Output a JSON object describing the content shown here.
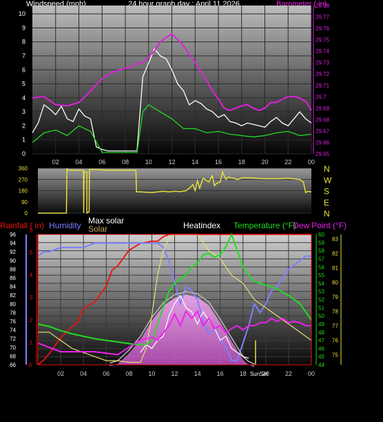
{
  "header": {
    "windspeed_label": "Windspeed (mph)",
    "title": "24 hour graph day : April 11 2026",
    "barometer_label": "Barometer ( in)"
  },
  "direction_letters": [
    "N",
    "W",
    "S",
    "E",
    "N"
  ],
  "bottom_labels": {
    "rainfall": "Rainfall ( in)",
    "humidity": "Humidity",
    "max_solar": "Max solar",
    "solar": "Solar",
    "heatindex": "Heatindex",
    "temperature": "Temperature (°F)",
    "dew_point": "Dew Point (°F)",
    "sunset": "SunSet"
  },
  "colors": {
    "windspeed": "#ffffff",
    "gust_avg": "#22dd22",
    "barometer": "#dd22dd",
    "direction": "#e8e040",
    "rainfall": "#ee1111",
    "humidity": "#7f7fff",
    "max_solar": "#bbbbbb",
    "solar": "#e8e070",
    "heatindex": "#ffffff",
    "temperature": "#22dd22",
    "dew_point": "#ee22ee"
  },
  "chart_data": [
    {
      "type": "line",
      "title": "24 hour graph day : April 11 2026",
      "x_ticks": [
        "02",
        "04",
        "06",
        "08",
        "10",
        "12",
        "14",
        "16",
        "18",
        "20",
        "22",
        "00"
      ],
      "ylabel_left": "Windspeed (mph)",
      "ylim_left": [
        0,
        10.6
      ],
      "yticks_left": [
        0,
        1,
        2,
        3,
        4,
        5,
        6,
        7,
        8,
        9,
        10
      ],
      "ylabel_right": "Barometer ( in)",
      "ylim_right": [
        29.65,
        29.78
      ],
      "yticks_right": [
        29.65,
        29.66,
        29.67,
        29.68,
        29.69,
        29.7,
        29.71,
        29.72,
        29.73,
        29.74,
        29.75,
        29.76,
        29.77,
        29.78
      ],
      "series": [
        {
          "name": "Windspeed (mph)",
          "axis": "left",
          "x": [
            0,
            0.5,
            1,
            1.5,
            2,
            2.5,
            3,
            3.5,
            4,
            4.5,
            5,
            5.5,
            6,
            6.5,
            7,
            7.5,
            8,
            8.5,
            9,
            9.5,
            10,
            10.5,
            11,
            11.5,
            12,
            12.5,
            13,
            13.5,
            14,
            14.5,
            15,
            15.5,
            16,
            16.5,
            17,
            17.5,
            18,
            18.5,
            19,
            19.5,
            20,
            20.5,
            21,
            21.5,
            22,
            22.5,
            23,
            23.5,
            24
          ],
          "y": [
            1.5,
            2.2,
            3.5,
            3.2,
            2.8,
            3.4,
            2.5,
            2.3,
            3.2,
            2.7,
            2.5,
            0.5,
            0.3,
            0.2,
            0.2,
            0.2,
            0.2,
            0.2,
            0.2,
            5.5,
            6.5,
            7.5,
            7.0,
            6.8,
            6.0,
            5.0,
            4.5,
            3.5,
            3.8,
            3.6,
            3.2,
            3.0,
            2.6,
            2.8,
            2.3,
            2.2,
            2.0,
            2.2,
            2.1,
            2.0,
            1.9,
            2.3,
            2.6,
            2.2,
            2.0,
            2.5,
            3.0,
            2.5,
            2.2
          ]
        },
        {
          "name": "Average wind",
          "axis": "left",
          "x": [
            0,
            1,
            2,
            3,
            4,
            5,
            6,
            7,
            8,
            9,
            9.5,
            10,
            11,
            12,
            13,
            14,
            15,
            16,
            17,
            18,
            19,
            20,
            21,
            22,
            23,
            24
          ],
          "y": [
            0.8,
            1.5,
            1.7,
            1.3,
            2.0,
            1.6,
            0.1,
            0.1,
            0.1,
            0.1,
            3.0,
            3.5,
            3.0,
            2.5,
            1.8,
            1.8,
            1.5,
            1.6,
            1.4,
            1.3,
            1.2,
            1.3,
            1.5,
            1.6,
            1.3,
            1.4
          ]
        },
        {
          "name": "Barometer ( in)",
          "axis": "right",
          "x": [
            0,
            1,
            2,
            3,
            4,
            5,
            6,
            7,
            8,
            8.5,
            9,
            9.5,
            10,
            10.5,
            11,
            11.5,
            12,
            12.5,
            13,
            13.5,
            14,
            14.5,
            15,
            15.5,
            16,
            16.5,
            17,
            17.5,
            18,
            18.5,
            19,
            19.5,
            20,
            20.5,
            21,
            21.5,
            22,
            22.5,
            23,
            23.3,
            23.6,
            24
          ],
          "y": [
            29.699,
            29.7,
            29.693,
            29.692,
            29.695,
            29.705,
            29.716,
            29.722,
            29.725,
            29.726,
            29.729,
            29.73,
            29.735,
            29.74,
            29.748,
            29.752,
            29.755,
            29.75,
            29.745,
            29.737,
            29.73,
            29.722,
            29.714,
            29.705,
            29.698,
            29.69,
            29.688,
            29.69,
            29.692,
            29.693,
            29.69,
            29.688,
            29.69,
            29.695,
            29.695,
            29.698,
            29.7,
            29.7,
            29.699,
            29.697,
            29.695,
            29.688
          ]
        }
      ]
    },
    {
      "type": "line",
      "title": "",
      "x_ticks": [],
      "ylabel_left": "",
      "ylim_left": [
        0,
        360
      ],
      "yticks_left": [
        0,
        90,
        180,
        270,
        360
      ],
      "y_right_labels": [
        "N",
        "W",
        "S",
        "E",
        "N"
      ],
      "series": [
        {
          "name": "Wind direction",
          "axis": "left",
          "x": [
            0,
            2.5,
            2.55,
            2.6,
            4,
            4.02,
            4.05,
            4.3,
            4.3,
            4.5,
            4.52,
            5,
            6,
            7,
            8,
            8.6,
            8.65,
            9,
            10,
            11,
            11.5,
            12,
            12.5,
            13,
            13.3,
            13.6,
            13.8,
            14,
            14.2,
            14.5,
            15,
            15.3,
            15.5,
            15.7,
            16,
            16.2,
            16.5,
            16.7,
            17,
            17.2,
            17.5,
            18,
            19,
            20,
            21,
            22,
            23,
            23.3,
            23.5,
            23.7,
            24
          ],
          "y": [
            0,
            0,
            360,
            345,
            345,
            0,
            330,
            330,
            0,
            10,
            350,
            350,
            345,
            345,
            345,
            345,
            170,
            170,
            165,
            175,
            170,
            175,
            172,
            180,
            200,
            230,
            180,
            260,
            200,
            280,
            250,
            300,
            220,
            240,
            250,
            330,
            270,
            290,
            280,
            280,
            270,
            285,
            280,
            275,
            275,
            280,
            270,
            250,
            165,
            175,
            170
          ]
        }
      ]
    },
    {
      "type": "line",
      "title": "",
      "x_ticks": [
        "02",
        "04",
        "06",
        "08",
        "10",
        "12",
        "14",
        "16",
        "18",
        "20",
        "22",
        "00"
      ],
      "axes": {
        "rainfall": {
          "label": "Rainfall ( in)",
          "ticks": [
            0,
            0.1,
            0.2,
            0.3,
            0.4,
            0.5,
            0.6
          ],
          "ylim": [
            0,
            0.58
          ]
        },
        "humidity": {
          "label": "Humidity",
          "ticks": [
            66,
            68,
            70,
            72,
            74,
            76,
            78,
            80,
            82,
            84,
            86,
            88,
            90,
            92,
            94,
            96
          ],
          "ylim": [
            66,
            96
          ]
        },
        "temperature": {
          "label": "Temperature (°F)",
          "ticks": [
            44,
            45,
            46,
            47,
            48,
            49,
            50,
            51,
            52,
            53,
            54,
            55,
            56,
            57,
            58,
            59,
            60
          ],
          "ylim": [
            44,
            60
          ]
        },
        "dew_point": {
          "label": "Dew Point (°F)",
          "ticks": [
            75,
            76,
            77,
            78,
            79,
            80,
            81,
            82,
            83
          ],
          "ylim": [
            74.3,
            83.3
          ]
        }
      },
      "annotations": [
        {
          "text": "SunSet",
          "x": 19.1
        }
      ],
      "series": [
        {
          "name": "Rainfall ( in)",
          "axis": "rainfall",
          "x": [
            0,
            0.5,
            1,
            2,
            3,
            3.5,
            4,
            5,
            6,
            6.5,
            7,
            8,
            9,
            10,
            10.5,
            11,
            11.5,
            12,
            24
          ],
          "y": [
            0,
            0.02,
            0.05,
            0.12,
            0.17,
            0.19,
            0.25,
            0.28,
            0.35,
            0.42,
            0.44,
            0.51,
            0.54,
            0.55,
            0.55,
            0.57,
            0.58,
            0.58,
            0.58
          ]
        },
        {
          "name": "Humidity",
          "axis": "humidity",
          "x": [
            0,
            0.5,
            1,
            2,
            3,
            4,
            5,
            6,
            7,
            8,
            9,
            10,
            10.5,
            11,
            11.5,
            12,
            12.5,
            13,
            13.5,
            14,
            14.5,
            15,
            15.5,
            16,
            16.5,
            17,
            17.5,
            18,
            18.5,
            19,
            19.5,
            20,
            20.5,
            21,
            21.5,
            22,
            22.5,
            23,
            23.5,
            24
          ],
          "y": [
            91,
            92,
            92,
            93,
            93,
            93,
            94,
            94,
            94,
            94,
            94,
            94,
            94,
            93,
            90,
            85,
            80,
            84,
            83,
            81,
            76,
            73,
            74,
            72,
            70,
            67,
            67,
            71,
            75,
            80,
            78,
            80,
            83,
            84,
            86,
            88,
            89,
            90,
            91,
            91
          ]
        },
        {
          "name": "Max solar",
          "axis": "temperature",
          "x": [
            6.3,
            7,
            8,
            9,
            10,
            11,
            12,
            13,
            14,
            15,
            16,
            17,
            18,
            18.5,
            19
          ],
          "y": [
            44.2,
            44.5,
            45.8,
            47.5,
            49.8,
            51.6,
            52.6,
            53,
            52.7,
            51.7,
            49.6,
            47.3,
            45,
            44.4,
            44.1
          ]
        },
        {
          "name": "Solar",
          "axis": "temperature",
          "x": [
            0,
            1,
            2,
            3,
            4,
            5,
            6,
            7,
            8,
            9,
            9.5,
            10,
            10.5,
            11,
            11.5,
            12,
            12.5,
            13,
            13.5,
            14,
            14.5,
            15,
            16,
            17,
            18,
            19,
            20,
            21,
            22,
            23,
            24
          ],
          "y": [
            48,
            48,
            47,
            46,
            45.5,
            45,
            44.5,
            44.5,
            44.3,
            44.3,
            46,
            50,
            55,
            58,
            59.5,
            60,
            60,
            60,
            60,
            60,
            59,
            58,
            57,
            55,
            54,
            52,
            51,
            50,
            49,
            48,
            47
          ]
        },
        {
          "name": "Heatindex",
          "axis": "temperature",
          "x": [
            9,
            9.5,
            10,
            10.5,
            11,
            11.5,
            12,
            12.5,
            13,
            13.5,
            14,
            14.5,
            15,
            15.5,
            16,
            16.5,
            17,
            17.5,
            18,
            18.5
          ],
          "y": [
            45.5,
            46.5,
            46,
            47,
            47.5,
            50,
            51.5,
            52.5,
            51,
            50.5,
            49,
            50.5,
            49.5,
            48.5,
            47,
            47.5,
            46,
            45.5,
            45,
            44.8
          ]
        },
        {
          "name": "Temperature (°F)",
          "axis": "temperature",
          "x": [
            0,
            1,
            2,
            3,
            4,
            5,
            6,
            7,
            8,
            8.5,
            9,
            9.5,
            10,
            10.5,
            11,
            11.5,
            12,
            12.5,
            13,
            13.5,
            14,
            14.5,
            15,
            15.5,
            16,
            16.5,
            17,
            17.5,
            18,
            18.5,
            19,
            19.5,
            20,
            21,
            22,
            23,
            23.5,
            24
          ],
          "y": [
            49,
            48.7,
            48.2,
            47.8,
            47.5,
            47.2,
            47,
            46.8,
            46.6,
            46.5,
            46.5,
            46.5,
            47,
            49,
            51,
            53,
            54,
            54.5,
            55,
            56,
            56.5,
            57.5,
            57.7,
            57.2,
            57.5,
            58.5,
            60,
            58,
            56,
            55,
            54.2,
            54,
            53.8,
            53.3,
            52.5,
            51.5,
            50.5,
            49.5
          ]
        },
        {
          "name": "Dew Point (°F)",
          "axis": "dew_point",
          "x": [
            0,
            1,
            2,
            3,
            4,
            5,
            6,
            7,
            8,
            9,
            10,
            10.5,
            11,
            11.5,
            12,
            12.5,
            13,
            13.5,
            14,
            14.5,
            15,
            15.5,
            16,
            16.5,
            17,
            17.5,
            18,
            18.5,
            19,
            19.5,
            20,
            20.5,
            21,
            21.5,
            22,
            22.5,
            23,
            23.5,
            24
          ],
          "y": [
            75.8,
            75.5,
            75.2,
            75.2,
            75.2,
            75.2,
            75.1,
            75,
            75.5,
            76,
            76.2,
            76,
            76.5,
            77,
            77.8,
            77,
            78,
            77.5,
            78,
            77,
            77.5,
            76.8,
            77,
            76.5,
            76.8,
            77,
            76.7,
            77,
            77,
            77.2,
            77.2,
            77.5,
            77.3,
            77.5,
            77.2,
            77.3,
            77.2,
            77,
            77
          ]
        }
      ]
    }
  ]
}
